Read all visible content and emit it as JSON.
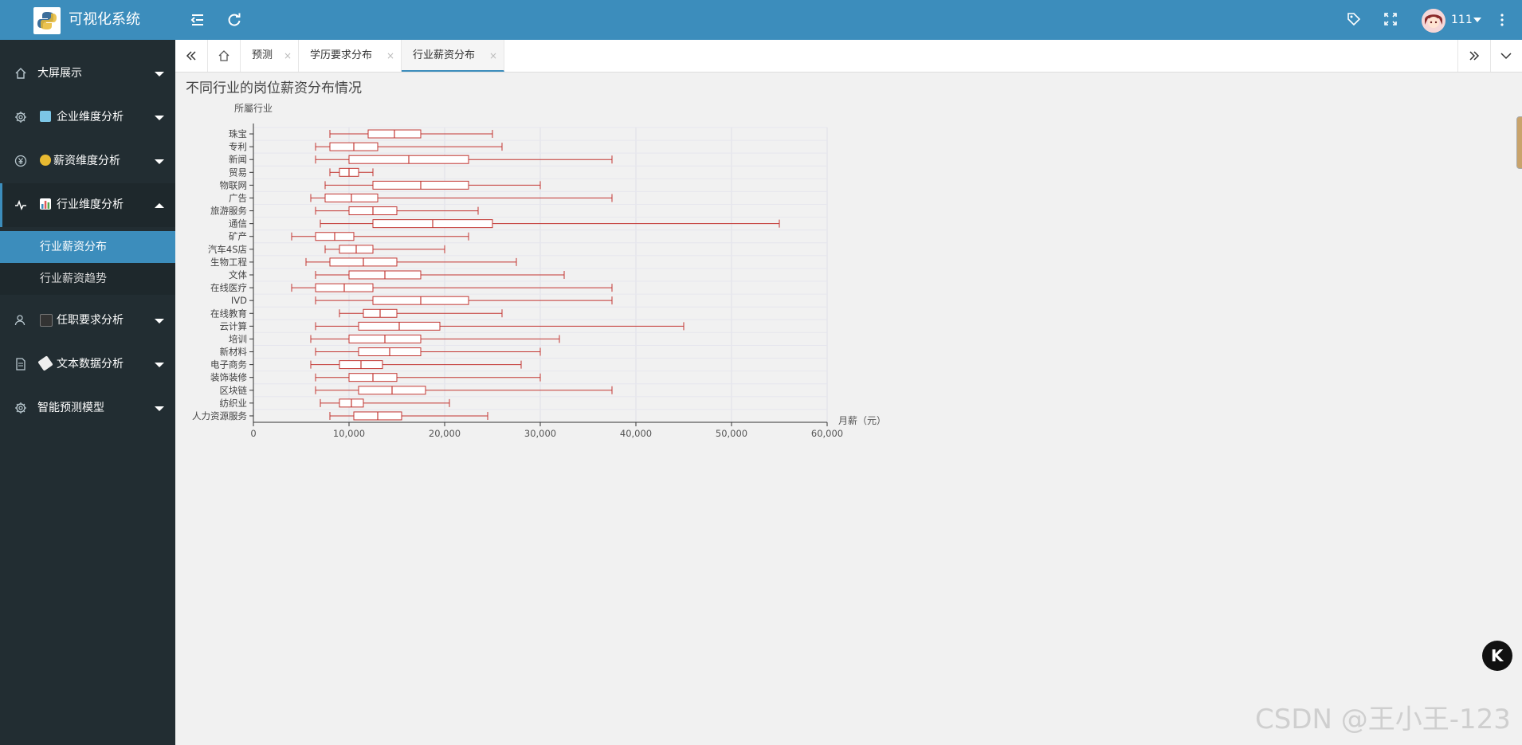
{
  "app": {
    "title": "可视化系统"
  },
  "header": {
    "icons": [
      "collapse-menu-icon",
      "refresh-icon",
      "tag-icon",
      "fullscreen-icon",
      "more-vertical-icon"
    ],
    "user_name": "111"
  },
  "sidebar": {
    "items": [
      {
        "label": "大屏展示",
        "icon": "home-icon"
      },
      {
        "label": "企业维度分析",
        "icon": "gear-icon",
        "emoji": "calendar-emoji"
      },
      {
        "label": "薪资维度分析",
        "icon": "yen-icon",
        "emoji": "money-bag-emoji"
      },
      {
        "label": "行业维度分析",
        "icon": "pulse-icon",
        "emoji": "bar-chart-emoji"
      },
      {
        "label": "任职要求分析",
        "icon": "user-icon",
        "emoji": "graduation-cap-emoji"
      },
      {
        "label": "文本数据分析",
        "icon": "file-icon",
        "emoji": "pill-emoji"
      },
      {
        "label": "智能预测模型",
        "icon": "gear-icon"
      }
    ],
    "submenu": [
      {
        "label": "行业薪资分布"
      },
      {
        "label": "行业薪资趋势"
      }
    ]
  },
  "tabs": [
    {
      "label": "预测"
    },
    {
      "label": "学历要求分布"
    },
    {
      "label": "行业薪资分布"
    }
  ],
  "tab_close": "×",
  "watermark": "CSDN @王小王-123",
  "badge": "K",
  "colors": {
    "header": "#3c8dbc",
    "sidebar": "#222d32",
    "box": "#c23531"
  },
  "chart_data": {
    "type": "boxplot",
    "title": "不同行业的岗位薪资分布情况",
    "ylabel": "所屬行业",
    "xlabel": "月薪（元）",
    "xlim": [
      0,
      60000
    ],
    "xticks": [
      "0",
      "10,000",
      "20,000",
      "30,000",
      "40,000",
      "50,000",
      "60,000"
    ],
    "categories": [
      "珠宝",
      "专利",
      "新闻",
      "贸易",
      "物联网",
      "广告",
      "旅游服务",
      "通信",
      "矿产",
      "汽车4S店",
      "生物工程",
      "文体",
      "在线医疗",
      "IVD",
      "在线教育",
      "云计算",
      "培训",
      "新材料",
      "电子商务",
      "装饰装修",
      "区块链",
      "纺织业",
      "人力资源服务"
    ],
    "series": [
      [
        8000,
        12000,
        17500,
        25000
      ],
      [
        6500,
        8000,
        13000,
        26000
      ],
      [
        6500,
        10000,
        22500,
        37500
      ],
      [
        8000,
        9000,
        11000,
        12500
      ],
      [
        7500,
        12500,
        22500,
        30000
      ],
      [
        6000,
        7500,
        13000,
        37500
      ],
      [
        6500,
        10000,
        15000,
        23500
      ],
      [
        7000,
        12500,
        25000,
        55000
      ],
      [
        4000,
        6500,
        10500,
        22500
      ],
      [
        7500,
        9000,
        12500,
        20000
      ],
      [
        5500,
        8000,
        15000,
        27500
      ],
      [
        6500,
        10000,
        17500,
        32500
      ],
      [
        4000,
        6500,
        12500,
        37500
      ],
      [
        6500,
        12500,
        22500,
        37500
      ],
      [
        9000,
        11500,
        15000,
        26000
      ],
      [
        6500,
        11000,
        19500,
        45000
      ],
      [
        6000,
        10000,
        17500,
        32000
      ],
      [
        6500,
        11000,
        17500,
        30000
      ],
      [
        6000,
        9000,
        13500,
        28000
      ],
      [
        6500,
        10000,
        15000,
        30000
      ],
      [
        6500,
        11000,
        18000,
        37500
      ],
      [
        7000,
        9000,
        11500,
        20500
      ],
      [
        8000,
        10500,
        15500,
        24500
      ]
    ]
  }
}
